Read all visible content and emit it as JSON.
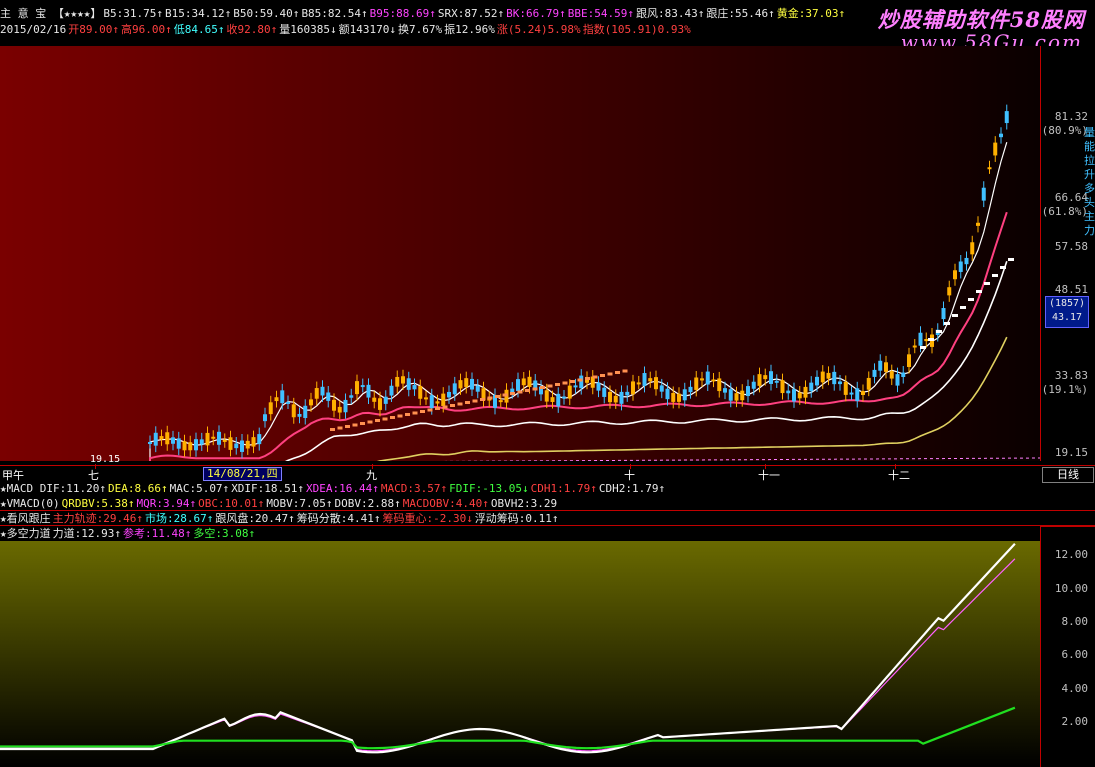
{
  "header": {
    "row1": [
      {
        "t": "主 意 宝 【★★★★】",
        "c": "c-white"
      },
      {
        "t": "B5:31.75↑",
        "c": "c-white"
      },
      {
        "t": "B15:34.12↑",
        "c": "c-white"
      },
      {
        "t": "B50:59.40↑",
        "c": "c-white"
      },
      {
        "t": "B85:82.54↑",
        "c": "c-white"
      },
      {
        "t": "B95:88.69↑",
        "c": "c-pink"
      },
      {
        "t": "SRX:87.52↑",
        "c": "c-white"
      },
      {
        "t": "BK:66.79↑",
        "c": "c-pink"
      },
      {
        "t": "BBE:54.59↑",
        "c": "c-pink"
      },
      {
        "t": "跟风:83.43↑",
        "c": "c-white"
      },
      {
        "t": "跟庄:55.46↑",
        "c": "c-white"
      },
      {
        "t": "黄金:37.03↑",
        "c": "c-yellow"
      }
    ],
    "row2": [
      {
        "t": "2015/02/16",
        "c": "c-white"
      },
      {
        "t": "开89.00↑",
        "c": "c-red"
      },
      {
        "t": "高96.00↑",
        "c": "c-red"
      },
      {
        "t": "低84.65↑",
        "c": "c-cyan"
      },
      {
        "t": "收92.80↑",
        "c": "c-red"
      },
      {
        "t": "量160385↓",
        "c": "c-white"
      },
      {
        "t": "额143170↓",
        "c": "c-white"
      },
      {
        "t": "换7.67%",
        "c": "c-white"
      },
      {
        "t": "振12.96%",
        "c": "c-white"
      },
      {
        "t": "涨(5.24)5.98%",
        "c": "c-red"
      },
      {
        "t": "指数(105.91)0.93%",
        "c": "c-red"
      }
    ],
    "logo": "炒股辅助软件58股网",
    "logo_url": "www.58Gu.com"
  },
  "price_axis": {
    "labels": [
      "81.32",
      "(80.9%)",
      "66.64",
      "(61.8%)",
      "57.58",
      "48.51",
      "33.83",
      "(19.1%)",
      "19.15"
    ],
    "current_box": [
      "(1857)",
      "43.17"
    ],
    "low_label": "19.15",
    "side_text": "量能拉升多头主力"
  },
  "time_axis": {
    "months": [
      "甲午",
      "七",
      "九",
      "十",
      "十一",
      "十二"
    ],
    "selected_date": "14/08/21,四",
    "period_button": "日线"
  },
  "indicators": {
    "row1": [
      {
        "t": "★MACD DIF:11.20↑",
        "c": "c-white"
      },
      {
        "t": "DEA:8.66↑",
        "c": "c-yellow"
      },
      {
        "t": "MAC:5.07↑",
        "c": "c-white"
      },
      {
        "t": "XDIF:18.51↑",
        "c": "c-white"
      },
      {
        "t": "XDEA:16.44↑",
        "c": "c-pink"
      },
      {
        "t": "MACD:3.57↑",
        "c": "c-red"
      },
      {
        "t": "FDIF:-13.05↓",
        "c": "c-green"
      },
      {
        "t": "CDH1:1.79↑",
        "c": "c-red"
      },
      {
        "t": "CDH2:1.79↑",
        "c": "c-white"
      }
    ],
    "row2": [
      {
        "t": "★VMACD(0)",
        "c": "c-white"
      },
      {
        "t": "QRDBV:5.38↑",
        "c": "c-yellow"
      },
      {
        "t": "MQR:3.94↑",
        "c": "c-pink"
      },
      {
        "t": "OBC:10.01↑",
        "c": "c-red"
      },
      {
        "t": "MOBV:7.05↑",
        "c": "c-white"
      },
      {
        "t": "DOBV:2.88↑",
        "c": "c-white"
      },
      {
        "t": "MACDOBV:4.40↑",
        "c": "c-red"
      },
      {
        "t": "OBVH2:3.29",
        "c": "c-white"
      }
    ],
    "row3": [
      {
        "t": "★看风跟庄",
        "c": "c-white"
      },
      {
        "t": "主力轨迹:29.46↑",
        "c": "c-red"
      },
      {
        "t": "市场:28.67↑",
        "c": "c-cyan"
      },
      {
        "t": "跟风盘:20.47↑",
        "c": "c-white"
      },
      {
        "t": "筹码分散:4.41↑",
        "c": "c-white"
      },
      {
        "t": "筹码重心:-2.30↓",
        "c": "c-red"
      },
      {
        "t": "浮动筹码:0.11↑",
        "c": "c-white"
      }
    ],
    "row4": [
      {
        "t": "★多空力道",
        "c": "c-white"
      },
      {
        "t": "力道:12.93↑",
        "c": "c-white"
      },
      {
        "t": "参考:11.48↑",
        "c": "c-pink"
      },
      {
        "t": "多空:3.08↑",
        "c": "c-green"
      }
    ]
  },
  "sub_axis": {
    "labels": [
      "12.00",
      "10.00",
      "8.00",
      "6.00",
      "4.00",
      "2.00"
    ]
  },
  "colors": {
    "chart_bg_left": "#7a0000",
    "chart_bg_right": "#0a0000",
    "sub_bg_top": "#6a6a00",
    "sub_bg_bottom": "#000000",
    "up_candle": "#ffb000",
    "down_candle": "#40c0ff",
    "frame": "#c00000"
  }
}
